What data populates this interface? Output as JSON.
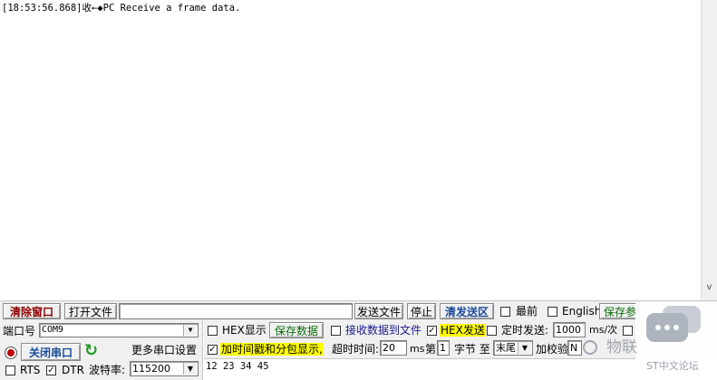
{
  "log": {
    "line1": "[18:53:56.868]收←◆PC Receive a frame data."
  },
  "scrollbar": {
    "down_arrow": "v"
  },
  "toolbar": {
    "clear_window": "清除窗口",
    "open_file": "打开文件",
    "file_path": "",
    "send_file": "发送文件",
    "stop": "停止",
    "clear_send": "清发送区",
    "topmost": "最前",
    "english": "English",
    "save_params": "保存参"
  },
  "port": {
    "port_label": "端口号",
    "port_value": "COM9",
    "close_port": "关闭串口",
    "more_settings": "更多串口设置",
    "rts": "RTS",
    "dtr": "DTR",
    "baud_label": "波特率:",
    "baud_value": "115200"
  },
  "options": {
    "hex_display": "HEX显示",
    "save_data": "保存数据",
    "recv_to_file": "接收数据到文件",
    "hex_send": "HEX发送",
    "timed_send": "定时发送:",
    "timed_value": "1000",
    "ms_per": "ms/次",
    "timestamp": "加时间戳和分包显示,",
    "timeout_label": "超时时间:",
    "timeout_value": "20",
    "ms": "ms",
    "byte_prefix": "第",
    "byte_index": "1",
    "byte_suffix": "字节 至",
    "end_value": "末尾",
    "checksum": "加校验",
    "checksum_value": "N"
  },
  "send": {
    "text": "12 23 34 45"
  },
  "watermark": {
    "brand": "物联",
    "forum": "ST中文论坛"
  },
  "colors": {
    "refresh_green": "#1a9a1a",
    "highlight": "#ffff00",
    "title_red": "#8b0000"
  }
}
